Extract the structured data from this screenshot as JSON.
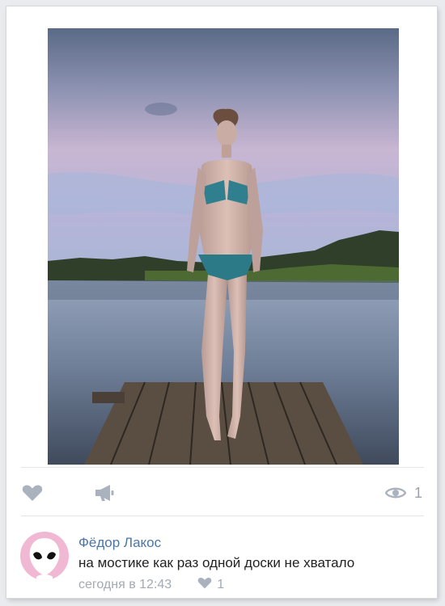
{
  "post": {
    "photo_alt": "photo",
    "views_count": "1"
  },
  "comment": {
    "author": "Фёдор Лакос",
    "text": "на мостике как раз одной доски не хватало",
    "time": "сегодня в 12:43",
    "likes": "1"
  },
  "colors": {
    "link": "#4a76a8",
    "icon": "#aab3bd",
    "meta": "#a3aab2",
    "avatar_bg": "#f0b8d3"
  },
  "icons": [
    "heart-icon",
    "megaphone-icon",
    "eye-icon",
    "alien-avatar-icon",
    "small-heart-icon"
  ]
}
